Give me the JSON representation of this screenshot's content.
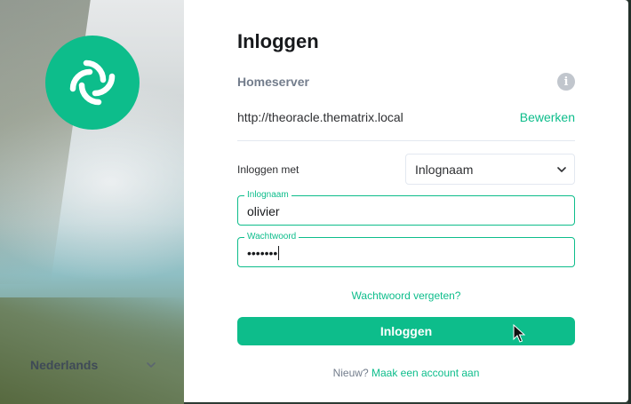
{
  "language": {
    "label": "Nederlands",
    "icon": "chevron-down-icon"
  },
  "logo": {
    "icon": "element-logo-icon",
    "color": "#0dbd8b"
  },
  "login": {
    "title": "Inloggen",
    "homeserver": {
      "label": "Homeserver",
      "info_icon": "info-icon",
      "url": "http://theoracle.thematrix.local",
      "edit_label": "Bewerken"
    },
    "login_with": {
      "label": "Inloggen met",
      "selected": "Inlognaam",
      "icon": "chevron-down-icon"
    },
    "username": {
      "label": "Inlognaam",
      "value": "olivier"
    },
    "password": {
      "label": "Wachtwoord",
      "value": "•••••••"
    },
    "forgot_label": "Wachtwoord vergeten?",
    "submit_label": "Inloggen",
    "footer": {
      "prefix": "Nieuw?",
      "link": "Maak een account aan"
    }
  },
  "colors": {
    "accent": "#0dbd8b",
    "text": "#17191c",
    "muted": "#737d8c",
    "border": "#e3e8f0"
  }
}
